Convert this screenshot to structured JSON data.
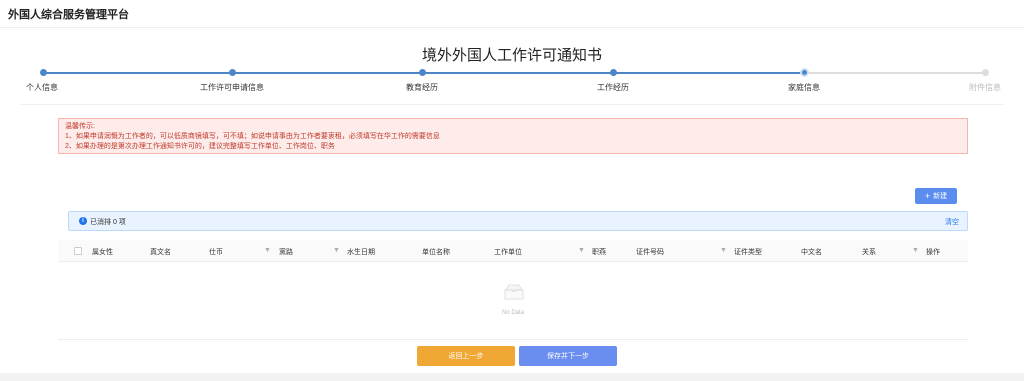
{
  "app": {
    "title": "外国人综合服务管理平台"
  },
  "page": {
    "title": "境外外国人工作许可通知书"
  },
  "steps": [
    {
      "label": "个人信息",
      "status": "done"
    },
    {
      "label": "工作许可申请信息",
      "status": "done"
    },
    {
      "label": "教育经历",
      "status": "done"
    },
    {
      "label": "工作经历",
      "status": "done"
    },
    {
      "label": "家庭信息",
      "status": "current"
    },
    {
      "label": "附件信息",
      "status": "pending"
    }
  ],
  "notice": {
    "title": "温馨传示:",
    "lines": [
      "1、如果申请润慨为工作者的，可以低质商镜填写，可不填；如说申请事由为工作者要衷租，必须填写在华工作的需要信息",
      "2、如果办理的是第次办理工作通知书许可的，建议完整填写工作单位、工作岗位、职务"
    ]
  },
  "toolbar": {
    "new_label": "新建",
    "new_icon": "plus-icon"
  },
  "selection": {
    "text": "已消排 0 项",
    "clear_label": "清空"
  },
  "table": {
    "columns": [
      "属女性",
      "真文名",
      "仕币",
      "黨路",
      "水生日期",
      "单位名称",
      "工作单位",
      "职燕",
      "证件号码",
      "证件类型",
      "中文名",
      "关系",
      "操作"
    ],
    "rows": [],
    "empty_text": "No Data"
  },
  "actions": {
    "back_label": "返回上一步",
    "save_label": "保存并下一步"
  },
  "colors": {
    "primary": "#5b8def",
    "back": "#f0a733",
    "step_active": "#4a86c8",
    "notice_bg": "#fdecea",
    "notice_text": "#c0392b"
  }
}
